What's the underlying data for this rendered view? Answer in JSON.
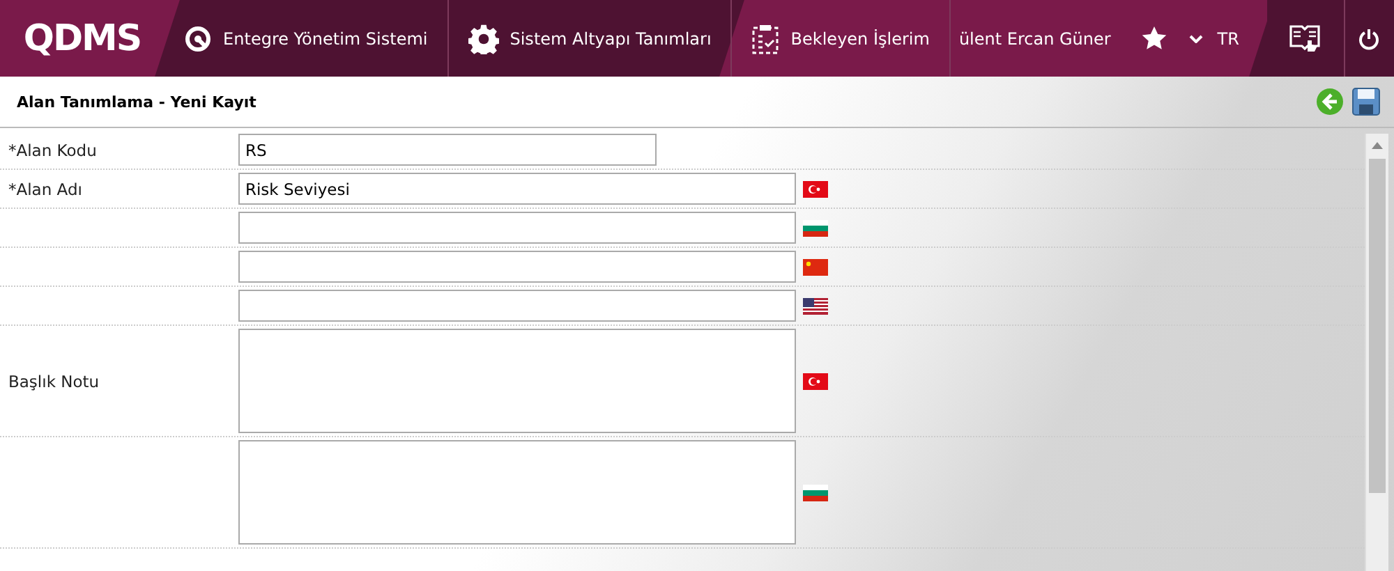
{
  "header": {
    "logo": "QDMS",
    "nav": [
      {
        "kind": "q",
        "label": "Entegre Yönetim Sistemi"
      },
      {
        "kind": "gear",
        "label": "Sistem Altyapı Tanımları"
      },
      {
        "kind": "clipboard",
        "label": "Bekleyen İşlerim"
      }
    ],
    "user": "ülent Ercan Güner",
    "language": "TR"
  },
  "page": {
    "title": "Alan Tanımlama - Yeni Kayıt"
  },
  "form": {
    "rows": [
      {
        "kind": "input",
        "label": "*Alan Kodu",
        "value": "RS"
      },
      {
        "kind": "input",
        "label": "*Alan Adı",
        "value": "Risk Seviyesi",
        "flag": {
          "kind": "tr"
        }
      },
      {
        "kind": "input",
        "label": "",
        "value": "",
        "flag": {
          "kind": "bg"
        }
      },
      {
        "kind": "input",
        "label": "",
        "value": "",
        "flag": {
          "kind": "cn"
        }
      },
      {
        "kind": "input",
        "label": "",
        "value": "",
        "flag": {
          "kind": "us"
        }
      },
      {
        "kind": "textarea",
        "label": "Başlık Notu",
        "value": "",
        "flag": {
          "kind": "tr"
        }
      },
      {
        "kind": "textarea",
        "label": "",
        "value": "",
        "flag": {
          "kind": "bg"
        }
      }
    ]
  }
}
